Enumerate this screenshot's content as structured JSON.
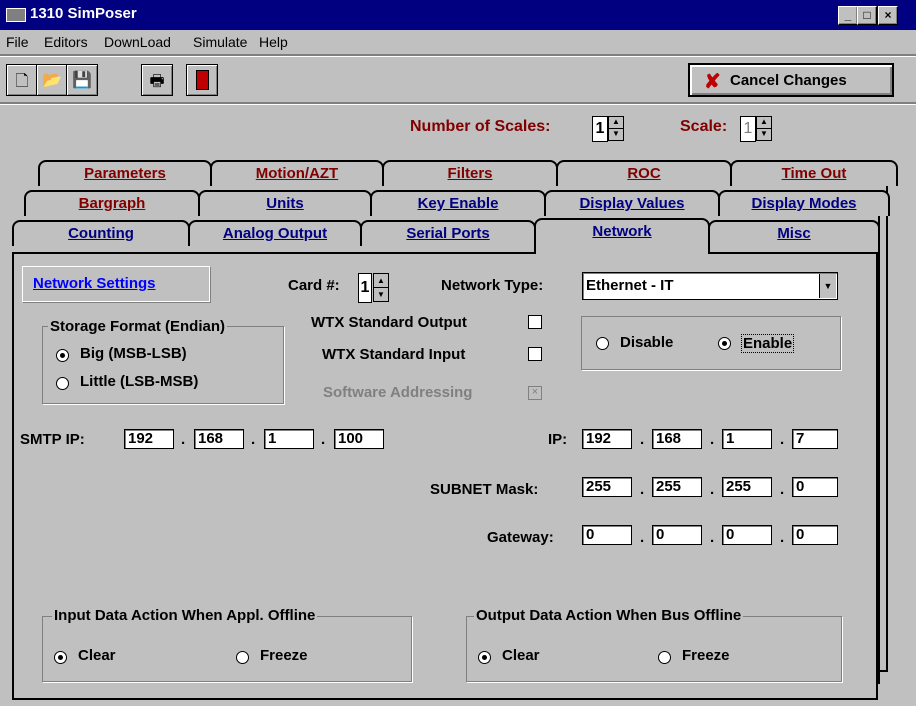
{
  "window": {
    "title": "1310 SimPoser"
  },
  "menu": {
    "items": [
      "File",
      "Editors",
      "DownLoad",
      "Simulate",
      "Help"
    ]
  },
  "toolbar": {
    "buttons": [
      "new-file",
      "open-folder",
      "save",
      "print",
      "exit"
    ],
    "cancel_label": "Cancel Changes"
  },
  "scales": {
    "number_label": "Number of Scales:",
    "number_value": "1",
    "scale_label": "Scale:",
    "scale_value": "1"
  },
  "tabs": {
    "row1": [
      "Parameters",
      "Motion/AZT",
      "Filters",
      "ROC",
      "Time Out"
    ],
    "row2": [
      "Bargraph",
      "Units",
      "Key Enable",
      "Display Values",
      "Display Modes"
    ],
    "row3": [
      "Counting",
      "Analog Output",
      "Serial Ports",
      "Network",
      "Misc"
    ],
    "active": "Network"
  },
  "network": {
    "settings_link": "Network Settings",
    "card_label": "Card #:",
    "card_value": "1",
    "type_label": "Network Type:",
    "type_value": "Ethernet - IT",
    "storage_title": "Storage Format (Endian)",
    "storage_big": "Big (MSB-LSB)",
    "storage_little": "Little (LSB-MSB)",
    "wtx_output": "WTX Standard Output",
    "wtx_input": "WTX Standard Input",
    "software_addressing": "Software Addressing",
    "disable_label": "Disable",
    "enable_label": "Enable",
    "smtp_label": "SMTP IP:",
    "smtp": [
      "192",
      "168",
      "1",
      "100"
    ],
    "ip_label": "IP:",
    "ip": [
      "192",
      "168",
      "1",
      "7"
    ],
    "subnet_label": "SUBNET Mask:",
    "subnet": [
      "255",
      "255",
      "255",
      "0"
    ],
    "gateway_label": "Gateway:",
    "gateway": [
      "0",
      "0",
      "0",
      "0"
    ],
    "input_group_title": "Input Data Action When Appl. Offline",
    "output_group_title": "Output Data Action When Bus Offline",
    "clear_label": "Clear",
    "freeze_label": "Freeze"
  }
}
